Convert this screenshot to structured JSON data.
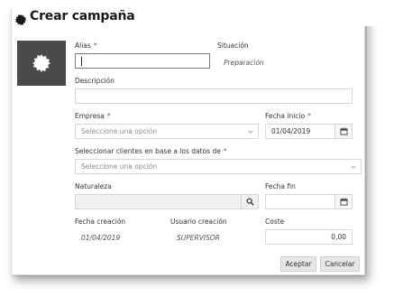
{
  "dialog": {
    "title": "Crear campaña",
    "title_icon": "gear-icon",
    "tile_icon": "gear-icon"
  },
  "form": {
    "alias": {
      "label": "Alias",
      "required_mark": "*",
      "value": ""
    },
    "situacion": {
      "label": "Situación",
      "value": "Preparación"
    },
    "descripcion": {
      "label": "Descripción",
      "value": ""
    },
    "empresa": {
      "label": "Empresa",
      "required_mark": "*",
      "placeholder": "Seleccione una opción"
    },
    "fecha_inicio": {
      "label": "Fecha inicio",
      "required_mark": "*",
      "value": "01/04/2019"
    },
    "clientes": {
      "label": "Seleccionar clientes en base a los datos de",
      "required_mark": "*",
      "placeholder": "Seleccione una opción"
    },
    "naturaleza": {
      "label": "Naturaleza",
      "value": ""
    },
    "fecha_fin": {
      "label": "Fecha fin",
      "value": ""
    },
    "fecha_creacion": {
      "label": "Fecha creación",
      "value": "01/04/2019"
    },
    "usuario_creacion": {
      "label": "Usuario creación",
      "value": "SUPERVISOR"
    },
    "coste": {
      "label": "Coste",
      "value": "0,00"
    }
  },
  "buttons": {
    "accept": "Aceptar",
    "cancel": "Cancelar"
  },
  "colors": {
    "required": "#c0392b",
    "tile_bg": "#4a4a4a"
  }
}
